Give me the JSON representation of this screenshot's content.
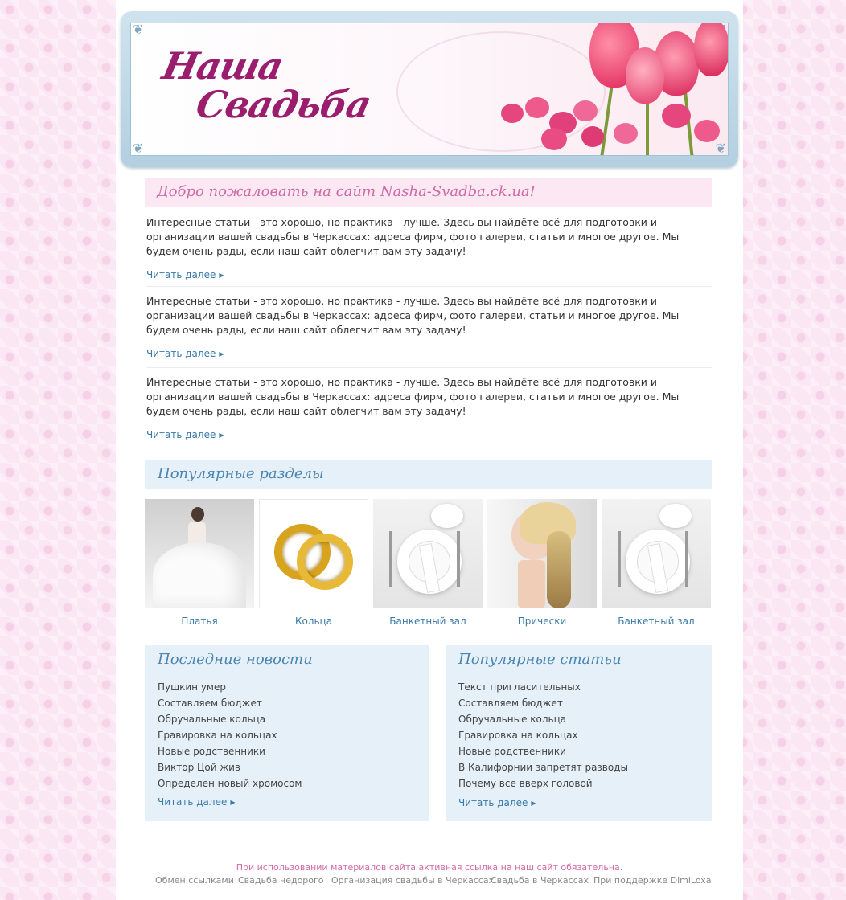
{
  "header": {
    "logo_line1": "Наша",
    "logo_line2": "Свадьба"
  },
  "welcome": {
    "title": "Добро пожаловать на сайт Nasha-Svadba.ck.ua!"
  },
  "articles": [
    {
      "text": "Интересные статьи - это хорошо, но практика - лучше. Здесь вы найдёте всё для подготовки и организации вашей свадьбы в Черкассах: адреса фирм, фото галереи, статьи и многое другое. Мы будем очень рады, если наш сайт облегчит вам эту задачу!",
      "more": "Читать далее"
    },
    {
      "text": "Интересные статьи - это хорошо, но практика - лучше. Здесь вы найдёте всё для подготовки и организации вашей свадьбы в Черкассах: адреса фирм, фото галереи, статьи и многое другое. Мы будем очень рады, если наш сайт облегчит вам эту задачу!",
      "more": "Читать далее"
    },
    {
      "text": "Интересные статьи - это хорошо, но практика - лучше. Здесь вы найдёте всё для подготовки и организации вашей свадьбы в Черкассах: адреса фирм, фото галереи, статьи и многое другое. Мы будем очень рады, если наш сайт облегчит вам эту задачу!",
      "more": "Читать далее"
    }
  ],
  "popular_sections": {
    "title": "Популярные разделы",
    "items": [
      {
        "label": "Платья",
        "icon": "wedding-dress-photo"
      },
      {
        "label": "Кольца",
        "icon": "rings-photo"
      },
      {
        "label": "Банкетный зал",
        "icon": "table-setting-photo"
      },
      {
        "label": "Прически",
        "icon": "hairstyle-photo"
      },
      {
        "label": "Банкетный зал",
        "icon": "table-setting-photo"
      }
    ]
  },
  "latest_news": {
    "title": "Последние новости",
    "items": [
      "Пушкин умер",
      "Составляем бюджет",
      "Обручальные кольца",
      "Гравировка на кольцах",
      "Новые родственники",
      "Виктор Цой жив",
      "Определен новый хромосом"
    ],
    "more": "Читать далее"
  },
  "popular_articles": {
    "title": "Популярные статьи",
    "items": [
      "Текст пригласительных",
      "Составляем бюджет",
      "Обручальные кольца",
      "Гравировка на кольцах",
      "Новые родственники",
      "В Калифорнии запретят разводы",
      "Почему все вверх головой"
    ],
    "more": "Читать далее"
  },
  "footer": {
    "note": "При использовании материалов сайта активная ссылка на наш сайт обязательна.",
    "links": [
      "Обмен ссылками",
      "Свадьба недорого",
      "Организация свадьбы в Черкассах",
      "Свадьба в Черкассах",
      "При поддержке DimiLoxa"
    ]
  },
  "colors": {
    "pink_heading": "#d06aa6",
    "blue_heading": "#4a86b1",
    "link": "#3b7ba8",
    "logo": "#9a1e6d"
  }
}
